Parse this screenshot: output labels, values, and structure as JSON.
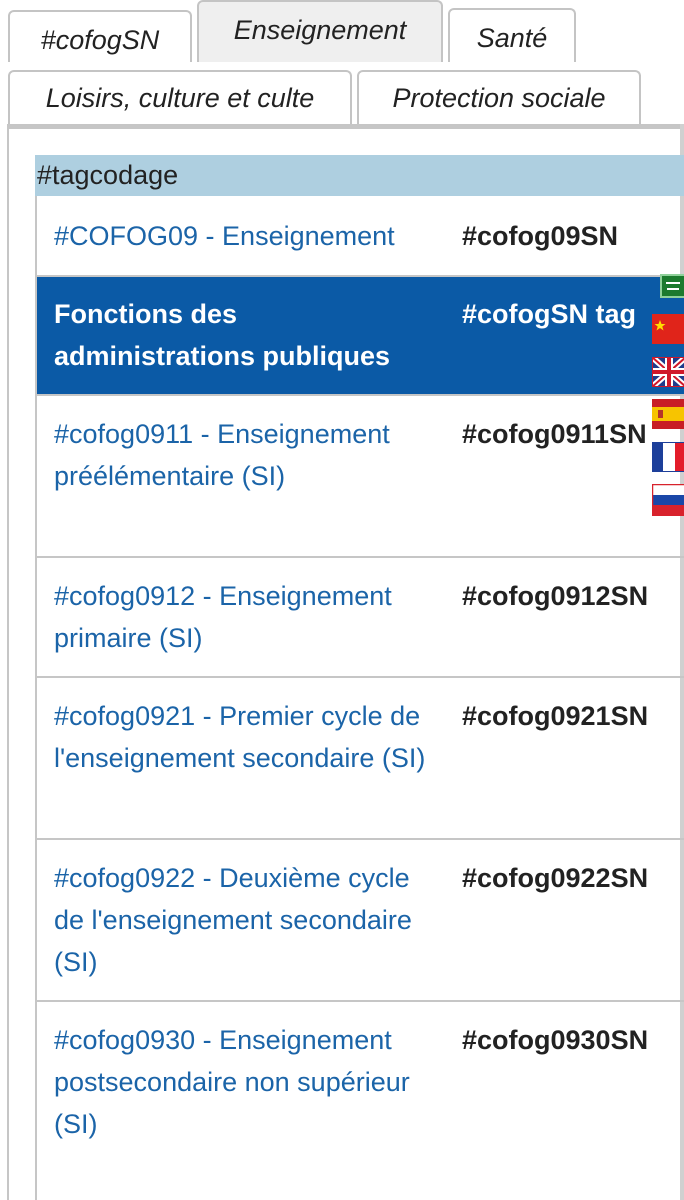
{
  "tabs": {
    "row1": [
      "#cofogSN",
      "Enseignement",
      "Santé"
    ],
    "row2": [
      "Loisirs, culture et culte",
      "Protection sociale"
    ],
    "active": "Enseignement"
  },
  "section": {
    "title": "#tagcodage"
  },
  "rows": [
    {
      "name": "#COFOG09 - Enseignement",
      "tag": "#cofog09SN"
    },
    {
      "name": "Fonctions des administrations publiques",
      "tag": "#cofogSN tag"
    },
    {
      "name": "#cofog0911 - Enseignement préélémentaire (SI)",
      "tag": "#cofog0911SN"
    },
    {
      "name": "#cofog0912 - Enseignement primaire (SI)",
      "tag": "#cofog0912SN"
    },
    {
      "name": "#cofog0921 - Premier cycle de l'enseignement secondaire (SI)",
      "tag": "#cofog0921SN"
    },
    {
      "name": "#cofog0922 - Deuxième cycle de l'enseignement secondaire (SI)",
      "tag": "#cofog0922SN"
    },
    {
      "name": "#cofog0930 - Enseignement postsecondaire non supérieur (SI)",
      "tag": "#cofog0930SN"
    }
  ],
  "flags": [
    "saudi-arabia-flag-icon",
    "china-flag-icon",
    "uk-flag-icon",
    "spain-flag-icon",
    "france-flag-icon",
    "russia-flag-icon"
  ],
  "colors": {
    "link": "#1b64a8",
    "header_row_bg": "#0b5aa6",
    "section_bg": "#aecfe0",
    "active_tab_bg": "#efefef"
  }
}
